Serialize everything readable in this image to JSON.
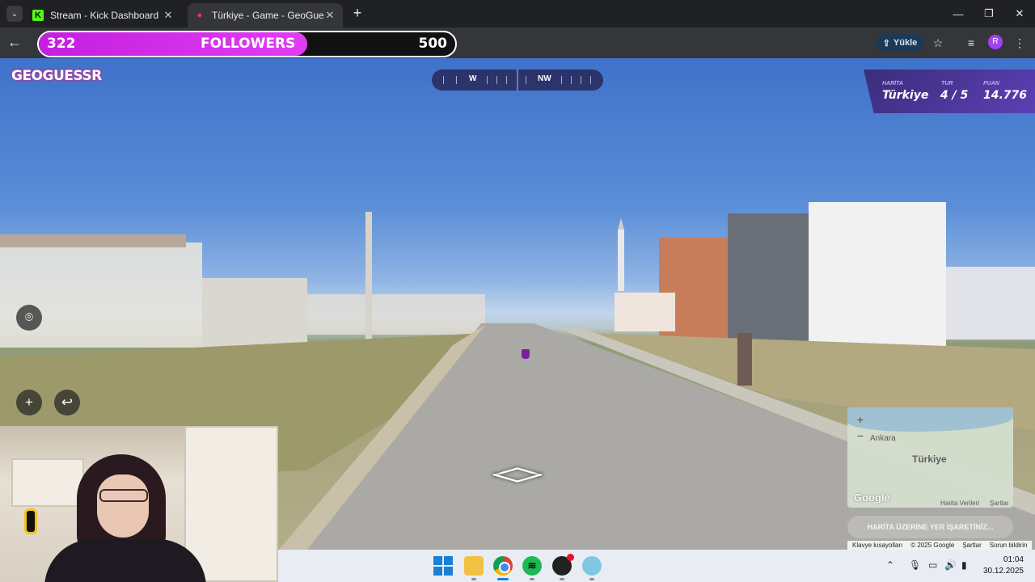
{
  "browser": {
    "tabs": [
      {
        "title": "Stream - Kick Dashboard",
        "favicon": "kick-icon",
        "active": false
      },
      {
        "title": "Türkiye - Game - GeoGuessr",
        "favicon": "geoguessr-pin-icon",
        "active": true
      }
    ],
    "new_tab": "+",
    "window_controls": {
      "minimize": "—",
      "maximize": "❐",
      "close": "✕"
    },
    "toolbar": {
      "back": "←",
      "upload_label": "Yükle",
      "profile_initial": "R"
    }
  },
  "follower_goal": {
    "current": "322",
    "label": "FOLLOWERS",
    "goal": "500",
    "progress": 0.644,
    "fill_color": "#e13ef2"
  },
  "game": {
    "logo": "GEOGUESSR",
    "compass": {
      "directions": [
        "W",
        "NW"
      ]
    },
    "hud": {
      "map_label": "HARİTA",
      "map_value": "Türkiye",
      "round_label": "TUR",
      "round_value": "4 / 5",
      "score_label": "PUAN",
      "score_value": "14.776"
    },
    "controls": {
      "zoom_in": "+",
      "undo": "↩"
    },
    "move_arrows": {
      "up": "︿",
      "down": "﹀"
    },
    "minimap": {
      "zoom_in": "+",
      "zoom_out": "−",
      "city_label": "Ankara",
      "country_label": "Türkiye",
      "google": "Google",
      "map_data": "Harita Verileri",
      "terms": "Şartlar"
    },
    "guess_button": "HARİTA ÜZERİNE YER İŞARETİNİZ...",
    "attribution": [
      "Klavye kısayolları",
      "© 2025 Google",
      "Şartlar",
      "Sorun bildirin"
    ]
  },
  "taskbar": {
    "apps": [
      "windows-start-icon",
      "file-explorer-icon",
      "chrome-icon",
      "spotify-icon",
      "obs-icon",
      "app-icon"
    ],
    "time": "01:04",
    "date": "30.12.2025"
  }
}
